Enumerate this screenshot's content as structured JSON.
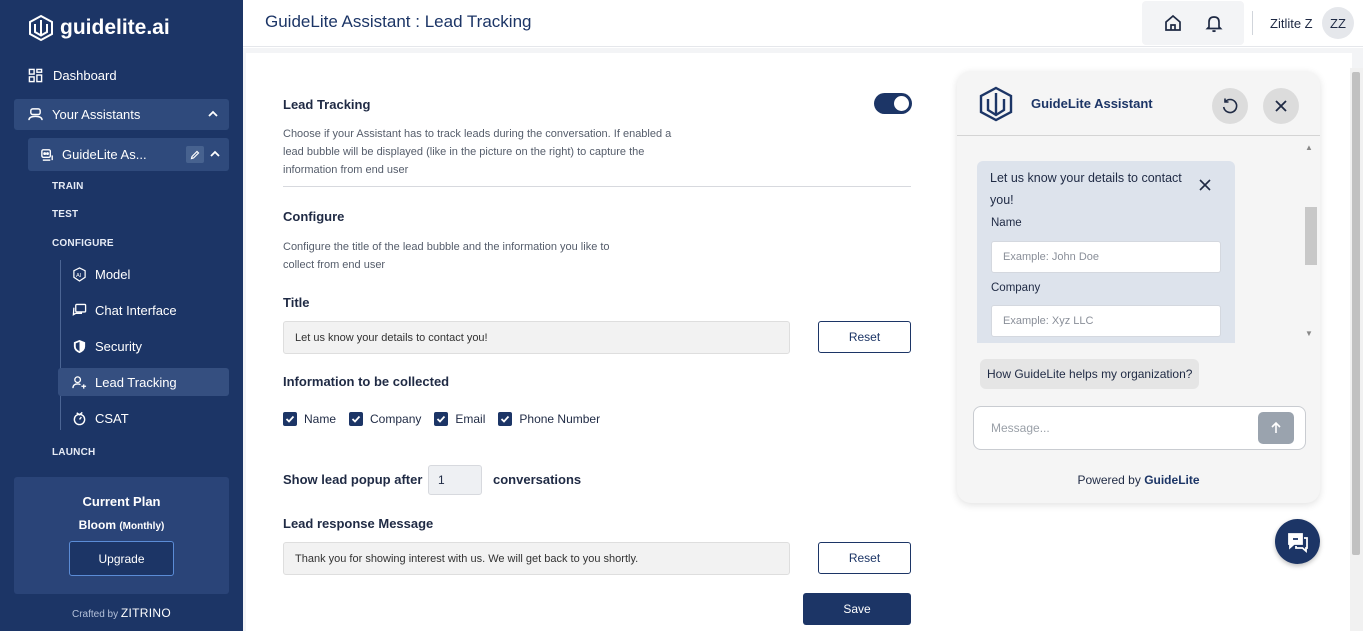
{
  "brand": {
    "name": "guidelite.ai"
  },
  "sidebar": {
    "dashboard": "Dashboard",
    "your_assistants": "Your Assistants",
    "assistant_name": "GuideLite As...",
    "sections": {
      "train": "TRAIN",
      "test": "TEST",
      "configure": "CONFIGURE",
      "launch": "LAUNCH"
    },
    "configure_items": [
      {
        "label": "Model",
        "icon": "ai-icon"
      },
      {
        "label": "Chat Interface",
        "icon": "chat-interface-icon"
      },
      {
        "label": "Security",
        "icon": "shield-icon"
      },
      {
        "label": "Lead Tracking",
        "icon": "lead-user-icon",
        "active": true
      },
      {
        "label": "CSAT",
        "icon": "csat-icon"
      }
    ],
    "plan": {
      "title": "Current Plan",
      "name": "Bloom",
      "period": "(Monthly)",
      "upgrade": "Upgrade"
    },
    "crafted_prefix": "Crafted by",
    "crafted_brand": "ZITRINO"
  },
  "header": {
    "title": "GuideLite Assistant : Lead Tracking",
    "user_name": "Zitlite Z",
    "avatar_initials": "ZZ"
  },
  "form": {
    "lead_tracking_label": "Lead Tracking",
    "lead_tracking_enabled": true,
    "lead_tracking_desc_1": "Choose if your Assistant has to track leads during the conversation. If enabled a",
    "lead_tracking_desc_2": "lead bubble will be displayed (like in the picture on the right) to capture the",
    "lead_tracking_desc_3": "information from end user",
    "configure_label": "Configure",
    "configure_desc_1": "Configure the title of the lead bubble and the information you like to",
    "configure_desc_2": "collect from end user",
    "title_label": "Title",
    "title_value": "Let us know your details to contact you!",
    "reset": "Reset",
    "info_label": "Information to be collected",
    "fields": [
      {
        "label": "Name",
        "checked": true
      },
      {
        "label": "Company",
        "checked": true
      },
      {
        "label": "Email",
        "checked": true
      },
      {
        "label": "Phone Number",
        "checked": true
      }
    ],
    "popup_prefix": "Show lead popup after",
    "popup_value": "1",
    "popup_suffix": "conversations",
    "response_label": "Lead response Message",
    "response_value": "Thank you for showing interest with us. We will get back to you shortly.",
    "save": "Save"
  },
  "chat": {
    "title": "GuideLite Assistant",
    "lead_title": "Let us know your details to contact you!",
    "name_label": "Name",
    "name_placeholder": "Example: John Doe",
    "company_label": "Company",
    "company_placeholder": "Example: Xyz LLC",
    "suggestion": "How GuideLite helps my organization?",
    "message_placeholder": "Message...",
    "powered_prefix": "Powered by",
    "powered_brand": "GuideLite"
  },
  "colors": {
    "primary": "#1c3566",
    "sidebar_active": "#2f4a7c"
  }
}
